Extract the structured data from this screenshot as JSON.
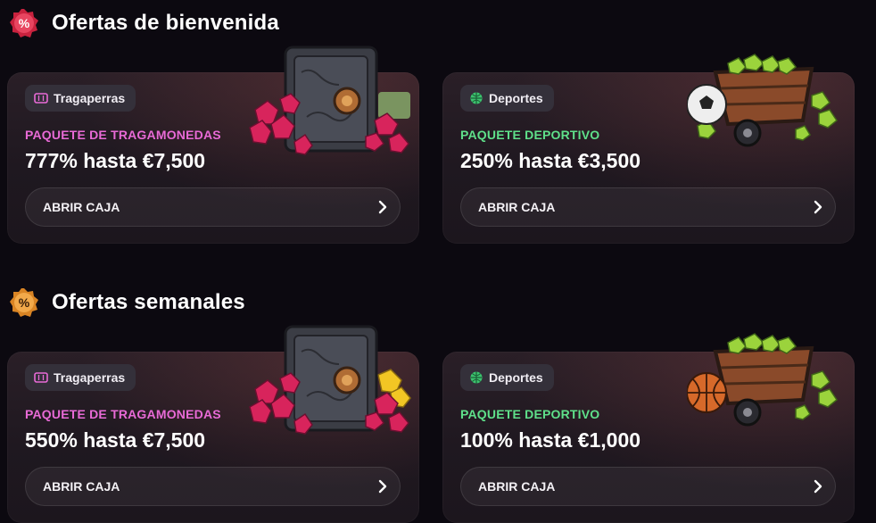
{
  "sections": [
    {
      "title": "Ofertas de bienvenida",
      "badge_color": "#e23a5a",
      "cards": [
        {
          "tag": "Tragaperras",
          "tag_icon": "slot-icon",
          "pkg": "PAQUETE DE TRAGAMONEDAS",
          "pkg_color": "#e86ad6",
          "offer": "777% hasta €7,500",
          "cta": "ABRIR CAJA",
          "art": "safe-with-gems"
        },
        {
          "tag": "Deportes",
          "tag_icon": "sports-icon",
          "pkg_a": "PAQUETE ",
          "pkg_b": "DEPORTIVO",
          "pkg_color_a": "#5fe08a",
          "pkg_color_b": "#5fe08a",
          "offer": "250% hasta €3,500",
          "cta": "ABRIR CAJA",
          "art": "cart-with-soccer-ball"
        }
      ]
    },
    {
      "title": "Ofertas semanales",
      "badge_color": "#f0a03a",
      "cards": [
        {
          "tag": "Tragaperras",
          "tag_icon": "slot-icon",
          "pkg": "PAQUETE DE TRAGAMONEDAS",
          "pkg_color": "#e86ad6",
          "offer": "550% hasta €7,500",
          "cta": "ABRIR CAJA",
          "art": "safe-with-gems-gold"
        },
        {
          "tag": "Deportes",
          "tag_icon": "sports-icon",
          "pkg_a": "PAQUETE ",
          "pkg_b": "DEPORTIVO",
          "pkg_color_a": "#5fe08a",
          "pkg_color_b": "#5fe08a",
          "offer": "100% hasta €1,000",
          "cta": "ABRIR CAJA",
          "art": "cart-with-basketball"
        }
      ]
    }
  ]
}
